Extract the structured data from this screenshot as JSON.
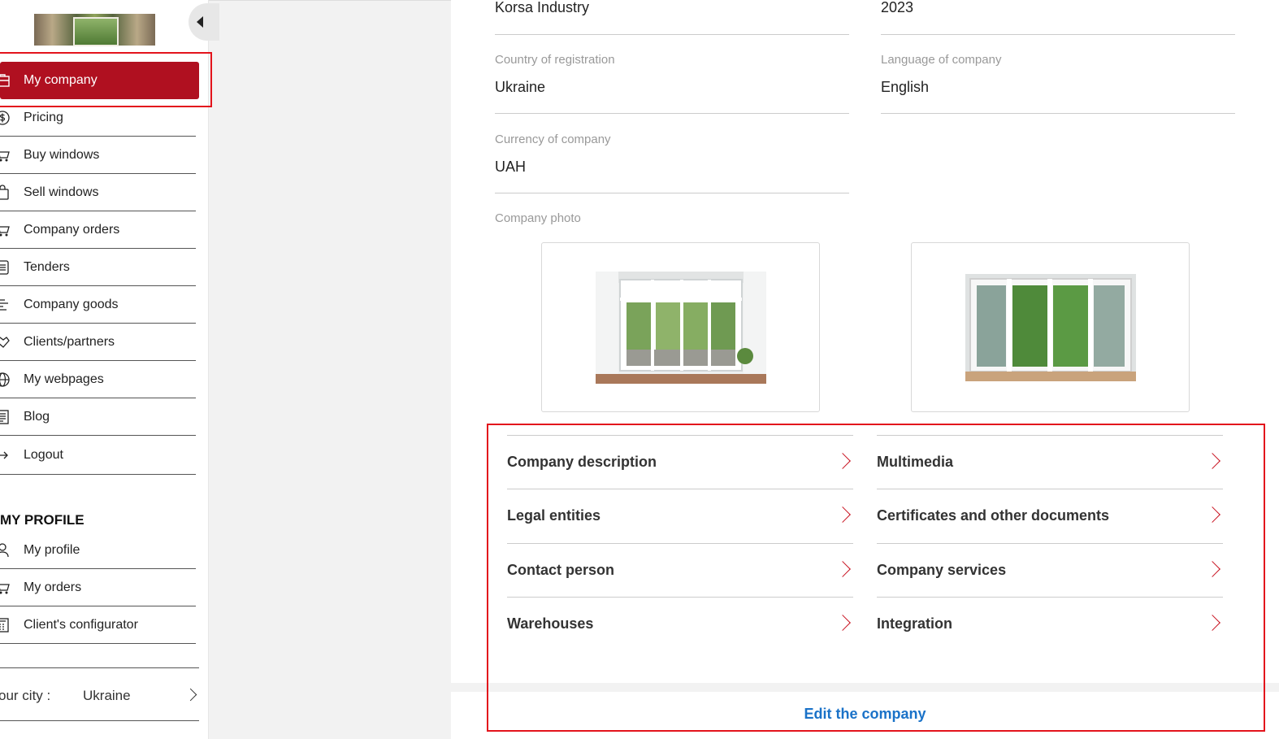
{
  "sidebar": {
    "menu": [
      {
        "label": "My company",
        "icon": "briefcase-icon",
        "active": true
      },
      {
        "label": "Pricing",
        "icon": "dollar-icon"
      },
      {
        "label": "Buy windows",
        "icon": "cart-icon"
      },
      {
        "label": "Sell windows",
        "icon": "bag-icon"
      },
      {
        "label": "Company orders",
        "icon": "cart-icon"
      },
      {
        "label": "Tenders",
        "icon": "list-icon"
      },
      {
        "label": "Company goods",
        "icon": "list-icon"
      },
      {
        "label": "Clients/partners",
        "icon": "handshake-icon"
      },
      {
        "label": "My webpages",
        "icon": "globe-icon"
      },
      {
        "label": "Blog",
        "icon": "document-icon"
      },
      {
        "label": "Logout",
        "icon": "logout-icon"
      }
    ],
    "profile_title": "MY PROFILE",
    "profile_menu": [
      {
        "label": "My profile",
        "icon": "user-icon"
      },
      {
        "label": "My orders",
        "icon": "cart-icon"
      },
      {
        "label": "Client's configurator",
        "icon": "calculator-icon"
      }
    ],
    "city": {
      "label": "our city :",
      "value": "Ukraine"
    }
  },
  "company": {
    "name_value": "Korsa Industry",
    "year_value": "2023",
    "country_label": "Country of registration",
    "country_value": "Ukraine",
    "language_label": "Language of company",
    "language_value": "English",
    "currency_label": "Currency of company",
    "currency_value": "UAH",
    "photo_label": "Company photo"
  },
  "sections": [
    {
      "label": "Company description"
    },
    {
      "label": "Multimedia"
    },
    {
      "label": "Legal entities"
    },
    {
      "label": "Certificates and other documents"
    },
    {
      "label": "Contact person"
    },
    {
      "label": "Company services"
    },
    {
      "label": "Warehouses"
    },
    {
      "label": "Integration"
    }
  ],
  "edit_label": "Edit the company",
  "colors": {
    "accent": "#b01020",
    "link": "#1a72c8",
    "highlight": "#e3141c"
  }
}
